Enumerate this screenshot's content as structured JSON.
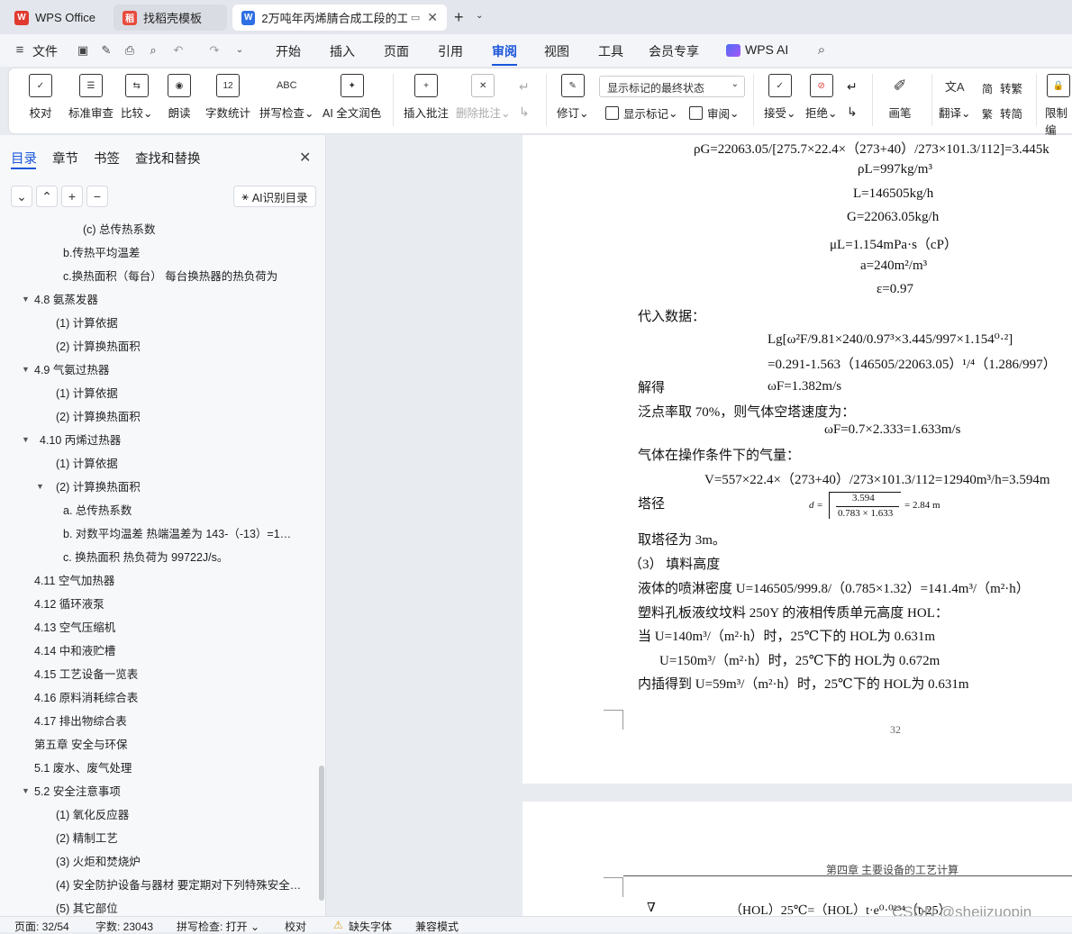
{
  "tabs": [
    {
      "label": "WPS Office"
    },
    {
      "label": "找稻壳模板"
    },
    {
      "label": "2万吨年丙烯腈合成工段的工"
    }
  ],
  "menu": {
    "file": "文件",
    "items": [
      "开始",
      "插入",
      "页面",
      "引用",
      "审阅",
      "视图",
      "工具",
      "会员专享"
    ],
    "wps_ai": "WPS AI"
  },
  "ribbon": {
    "proofread": "校对",
    "std_review": "标准审查",
    "compare": "比较",
    "read": "朗读",
    "wordcount": "字数统计",
    "spell": "拼写检查",
    "ai_polish": "AI 全文润色",
    "insert_comment": "插入批注",
    "delete_comment": "删除批注",
    "revise": "修订",
    "markup_select": "显示标记的最终状态",
    "show_markup": "显示标记",
    "review": "审阅",
    "accept": "接受",
    "reject": "拒绝",
    "pen": "画笔",
    "translate": "翻译",
    "to_trad": "转繁",
    "to_simp": "转简",
    "restrict": "限制编"
  },
  "sidebar": {
    "tabs": [
      "目录",
      "章节",
      "书签",
      "查找和替换"
    ],
    "ai_toc": "AI识别目录",
    "items": [
      "(c)  总传热系数",
      "b.传热平均温差",
      "c.换热面积（每台）       每台换热器的热负荷为",
      "4.8 氨蒸发器",
      "(1)   计算依据",
      "(2) 计算换热面积",
      "4.9  气氨过热器",
      "(1) 计算依据",
      "(2) 计算换热面积",
      "4.10  丙烯过热器",
      "(1) 计算依据",
      "(2) 计算换热面积",
      "a. 总传热系数",
      "b. 对数平均温差     热端温差为 143-（-13）=1…",
      "c. 换热面积     热负荷为 99722J/s。",
      "4.11 空气加热器",
      "4.12  循环液泵",
      "4.13  空气压缩机",
      "4.14 中和液贮槽",
      "4.15 工艺设备一览表",
      "4.16 原料消耗综合表",
      "4.17 排出物综合表",
      "第五章    安全与环保",
      "5.1 废水、废气处理",
      "5.2 安全注意事项",
      "(1) 氧化反应器",
      "(2) 精制工艺",
      "(3) 火炬和焚烧炉",
      "(4) 安全防护设备与器材  要定期对下列特殊安全…",
      "(5) 其它部位"
    ]
  },
  "doc": {
    "lines": [
      "ρG=22063.05/[275.7×22.4×（273+40）/273×101.3/112]=3.445k",
      "ρL=997kg/m³",
      "L=146505kg/h",
      "G=22063.05kg/h",
      "μL=1.154mPa·s（cP）",
      "a=240m²/m³",
      "ε=0.97",
      "代入数据：",
      "Lg[ω²F/9.81×240/0.97³×3.445/997×1.154⁰·²]",
      "=0.291-1.563（146505/22063.05）¹/⁴（1.286/997）",
      "解得",
      "ωF=1.382m/s",
      "泛点率取 70%，则气体空塔速度为：",
      "ωF=0.7×2.333=1.633m/s",
      "气体在操作条件下的气量：",
      "V=557×22.4×（273+40）/273×101.3/112=12940m³/h=3.594m",
      "塔径",
      "d =",
      "3.594",
      "0.783 × 1.633",
      "= 2.84 m",
      "取塔径为 3m。",
      "（3）  填料高度",
      "液体的喷淋密度       U=146505/999.8/（0.785×1.32）=141.4m³/（m²·h）",
      "塑料孔板液纹坟料 250Y 的液相传质单元高度 HOL：",
      "当  U=140m³/（m²·h）时，25℃下的 HOL为 0.631m",
      "U=150m³/（m²·h）时，25℃下的 HOL为 0.672m",
      "内插得到    U=59m³/（m²·h）时，25℃下的 HOL为 0.631m"
    ],
    "page_number": "32",
    "header2": "第四章    主要设备的工艺计算",
    "formula2": "（HOL）25℃=（HOL）t·e⁰·⁰²³⁴（t-25）"
  },
  "status": {
    "page": "页面: 32/54",
    "words": "字数: 23043",
    "spell": "拼写检查: 打开",
    "proof": "校对",
    "font": "缺失字体",
    "compat": "兼容模式"
  },
  "watermark": "CSDN @shejizuopin"
}
